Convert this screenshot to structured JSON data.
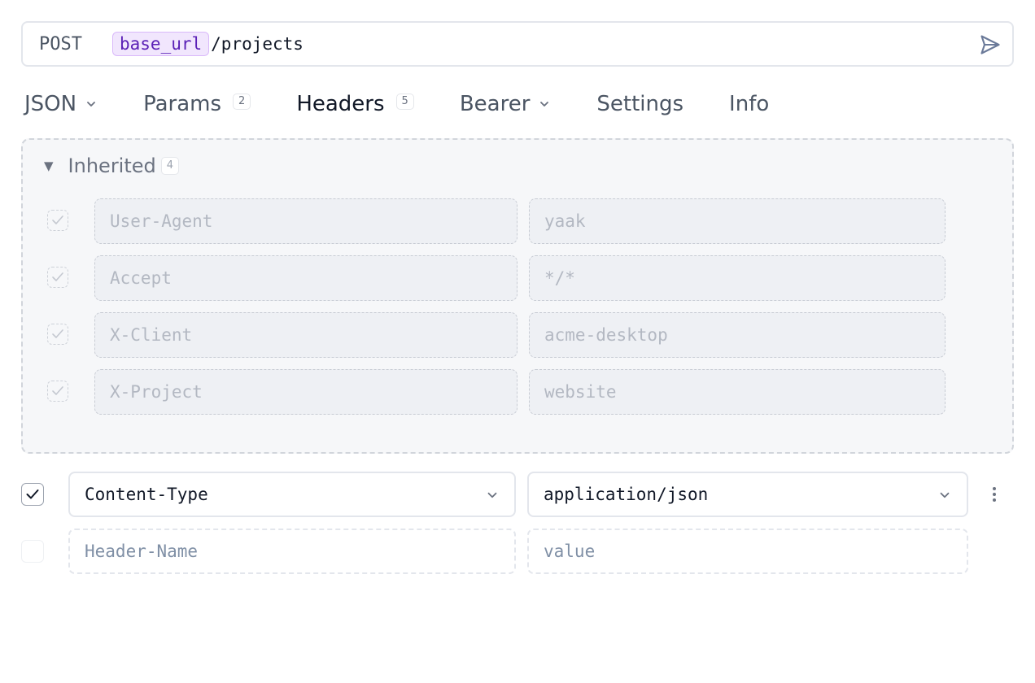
{
  "request": {
    "method": "POST",
    "url_variable": "base_url",
    "url_path": "/projects"
  },
  "tabs": [
    {
      "label": "JSON",
      "dropdown": true
    },
    {
      "label": "Params",
      "count": "2"
    },
    {
      "label": "Headers",
      "count": "5",
      "active": true
    },
    {
      "label": "Bearer",
      "dropdown": true
    },
    {
      "label": "Settings"
    },
    {
      "label": "Info"
    }
  ],
  "inherited": {
    "label": "Inherited",
    "count": "4",
    "rows": [
      {
        "name": "User-Agent",
        "value": "yaak"
      },
      {
        "name": "Accept",
        "value": "*/*"
      },
      {
        "name": "X-Client",
        "value": "acme-desktop"
      },
      {
        "name": "X-Project",
        "value": "website"
      }
    ]
  },
  "headers": {
    "rows": [
      {
        "name": "Content-Type",
        "value": "application/json",
        "enabled": true
      }
    ],
    "new_row": {
      "name_placeholder": "Header-Name",
      "value_placeholder": "value"
    }
  },
  "colors": {
    "accent_variable_bg": "#f1e6fd",
    "accent_variable_text": "#5b21b6"
  },
  "icons": {
    "send": "send-icon",
    "dropdown": "chevron-down-icon",
    "check": "check-icon",
    "more": "more-vertical-icon",
    "collapse": "triangle-down-icon"
  }
}
